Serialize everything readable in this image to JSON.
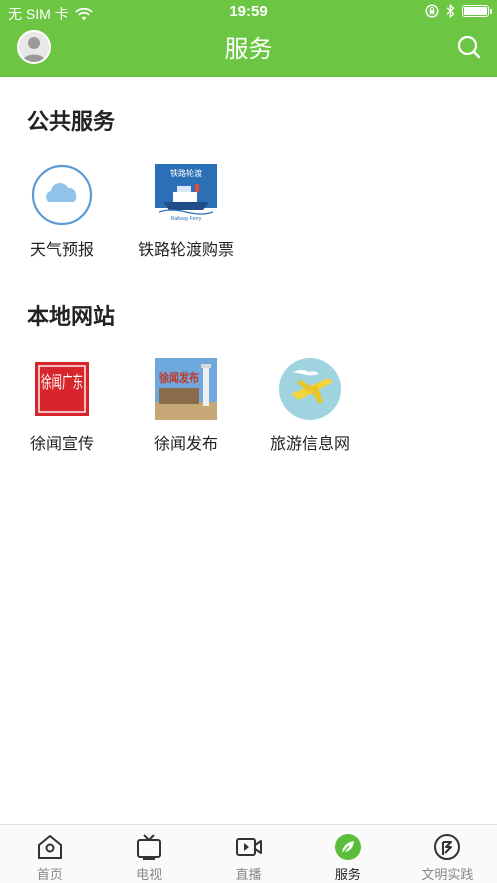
{
  "status_bar": {
    "carrier": "无 SIM 卡",
    "time": "19:59"
  },
  "header": {
    "title": "服务"
  },
  "sections": [
    {
      "title": "公共服务",
      "items": [
        {
          "label": "天气预报",
          "icon": "weather-cloud-icon"
        },
        {
          "label": "铁路轮渡购票",
          "icon": "railway-ferry-icon",
          "logo_text": "铁路轮渡",
          "logo_subtext": "Railway Ferry"
        }
      ]
    },
    {
      "title": "本地网站",
      "items": [
        {
          "label": "徐闻宣传",
          "icon": "xuwen-seal-icon",
          "seal_text": "徐闻广东"
        },
        {
          "label": "徐闻发布",
          "icon": "xuwen-release-icon",
          "logo_text": "徐闻发布"
        },
        {
          "label": "旅游信息网",
          "icon": "airplane-icon"
        }
      ]
    }
  ],
  "tabbar": {
    "items": [
      {
        "label": "首页",
        "icon": "home-icon",
        "active": false
      },
      {
        "label": "电视",
        "icon": "tv-icon",
        "active": false
      },
      {
        "label": "直播",
        "icon": "live-video-icon",
        "active": false
      },
      {
        "label": "服务",
        "icon": "service-leaf-icon",
        "active": true
      },
      {
        "label": "文明实践",
        "icon": "civilization-practice-icon",
        "active": false
      }
    ]
  },
  "colors": {
    "brand_green": "#6cc644",
    "active_tab_green": "#5cbd3a",
    "weather_blue": "#5b9bd5",
    "seal_red": "#d6262b",
    "airplane_yellow": "#f2d43b",
    "airplane_bg": "#9fd3e0"
  }
}
